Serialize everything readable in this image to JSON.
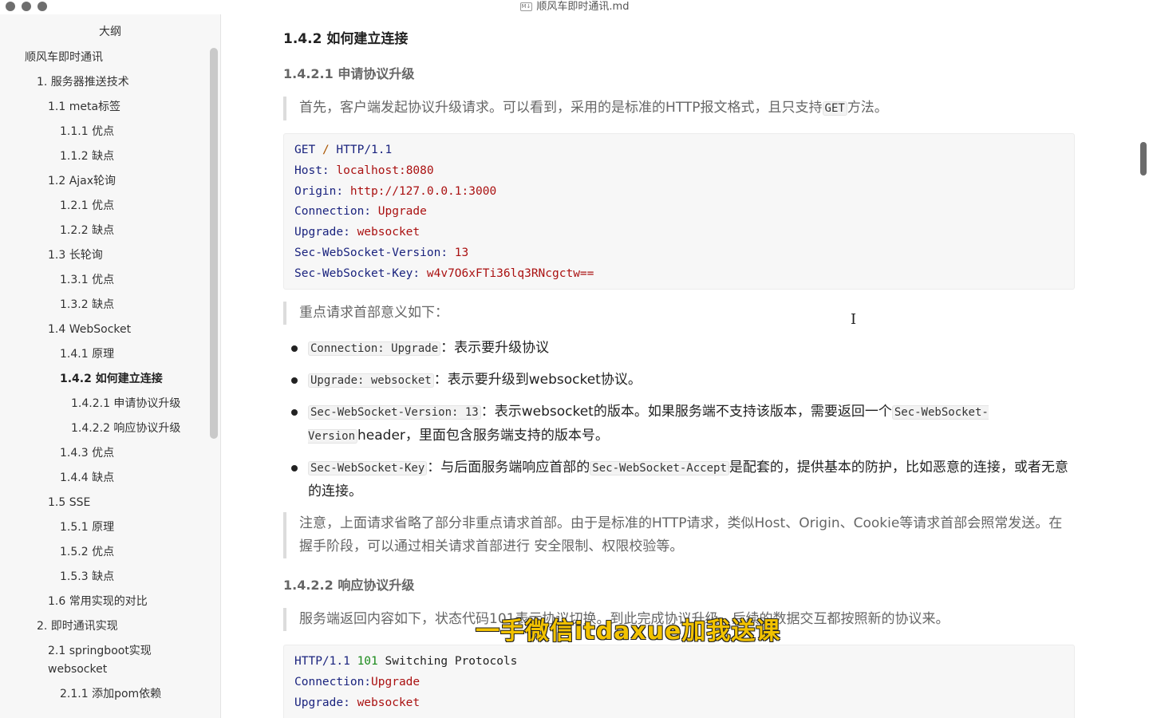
{
  "window": {
    "title": "顺风车即时通讯.md",
    "file_badge": "M↓"
  },
  "sidebar": {
    "title": "大纲",
    "items": [
      {
        "label": "顺风车即时通讯",
        "level": 1
      },
      {
        "label": "1. 服务器推送技术",
        "level": 2
      },
      {
        "label": "1.1 meta标签",
        "level": 3
      },
      {
        "label": "1.1.1 优点",
        "level": 4
      },
      {
        "label": "1.1.2 缺点",
        "level": 4
      },
      {
        "label": "1.2 Ajax轮询",
        "level": 3
      },
      {
        "label": "1.2.1 优点",
        "level": 4
      },
      {
        "label": "1.2.2 缺点",
        "level": 4
      },
      {
        "label": "1.3 长轮询",
        "level": 3
      },
      {
        "label": "1.3.1 优点",
        "level": 4
      },
      {
        "label": "1.3.2 缺点",
        "level": 4
      },
      {
        "label": "1.4 WebSocket",
        "level": 3
      },
      {
        "label": "1.4.1 原理",
        "level": 4
      },
      {
        "label": "1.4.2 如何建立连接",
        "level": 4,
        "active": true
      },
      {
        "label": "1.4.2.1 申请协议升级",
        "level": 5
      },
      {
        "label": "1.4.2.2 响应协议升级",
        "level": 5
      },
      {
        "label": "1.4.3 优点",
        "level": 4
      },
      {
        "label": "1.4.4 缺点",
        "level": 4
      },
      {
        "label": "1.5 SSE",
        "level": 3
      },
      {
        "label": "1.5.1 原理",
        "level": 4
      },
      {
        "label": "1.5.2 优点",
        "level": 4
      },
      {
        "label": "1.5.3 缺点",
        "level": 4
      },
      {
        "label": "1.6 常用实现的对比",
        "level": 3
      },
      {
        "label": "2. 即时通讯实现",
        "level": 2
      },
      {
        "label": "2.1 springboot实现websocket",
        "level": 3,
        "wrap": true
      },
      {
        "label": "2.1.1 添加pom依赖",
        "level": 4
      }
    ]
  },
  "doc": {
    "h_142": "1.4.2 如何建立连接",
    "h_1421": "1.4.2.1 申请协议升级",
    "quote1_a": "首先，客户端发起协议升级请求。可以看到，采用的是标准的HTTP报文格式，且只支持",
    "quote1_code": "GET",
    "quote1_b": "方法。",
    "code1": {
      "line1_method": "GET",
      "line1_path": "/",
      "line1_proto": "HTTP/1.1",
      "host_k": "Host:",
      "host_v": "localhost:8080",
      "origin_k": "Origin:",
      "origin_v": "http://127.0.0.1:3000",
      "conn_k": "Connection:",
      "conn_v": "Upgrade",
      "upg_k": "Upgrade:",
      "upg_v": "websocket",
      "ver_k": "Sec-WebSocket-Version:",
      "ver_v": "13",
      "key_k": "Sec-WebSocket-Key:",
      "key_v": "w4v7O6xFTi36lq3RNcgctw=="
    },
    "quote2": "重点请求首部意义如下：",
    "bullets": [
      {
        "code": "Connection: Upgrade",
        "text": "：表示要升级协议"
      },
      {
        "code": "Upgrade: websocket",
        "text": "：表示要升级到websocket协议。"
      },
      {
        "code": "Sec-WebSocket-Version: 13",
        "text": "：表示websocket的版本。如果服务端不支持该版本，需要返回一个",
        "code2": "Sec-WebSocket-Version",
        "text2": "header，里面包含服务端支持的版本号。"
      },
      {
        "code": "Sec-WebSocket-Key",
        "text": "：与后面服务端响应首部的",
        "code2": "Sec-WebSocket-Accept",
        "text2": "是配套的，提供基本的防护，比如恶意的连接，或者无意的连接。"
      }
    ],
    "quote3": "注意，上面请求省略了部分非重点请求首部。由于是标准的HTTP请求，类似Host、Origin、Cookie等请求首部会照常发送。在握手阶段，可以通过相关请求首部进行 安全限制、权限校验等。",
    "h_1422": "1.4.2.2 响应协议升级",
    "quote4": "服务端返回内容如下，状态代码101表示协议切换。到此完成协议升级，后续的数据交互都按照新的协议来。",
    "code2": {
      "status_proto": "HTTP/1.1",
      "status_code": "101",
      "status_text": "Switching Protocols",
      "conn_k": "Connection:",
      "conn_v": "Upgrade",
      "upg_k": "Upgrade:",
      "upg_v": "websocket"
    }
  },
  "overlay": {
    "watermark": "一手微信itdaxue加我送课"
  },
  "icons": {
    "text_cursor": "I"
  }
}
